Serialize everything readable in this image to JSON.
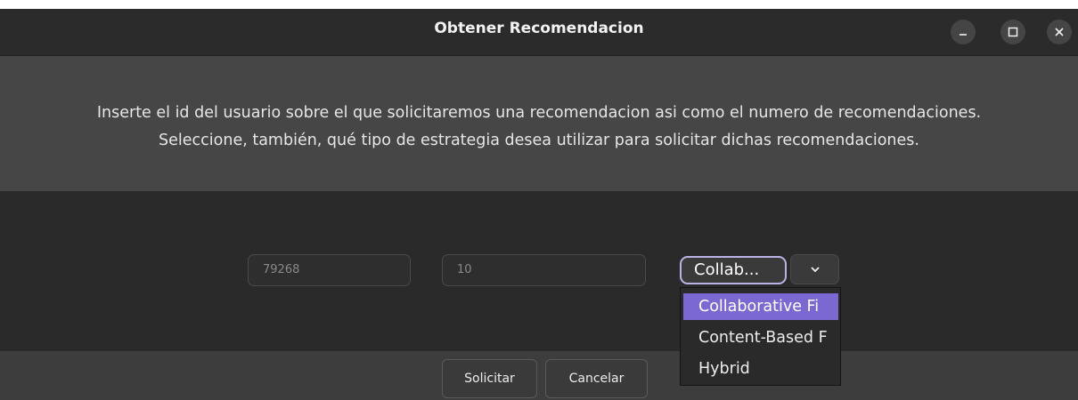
{
  "window": {
    "title": "Obtener Recomendacion"
  },
  "message": {
    "line1": "Inserte el id del usuario sobre el que solicitaremos una recomendacion asi como el numero de recomendaciones.",
    "line2": "Seleccione, también, qué tipo de estrategia desea utilizar para solicitar dichas recomendaciones."
  },
  "form": {
    "user_id_value": "79268",
    "num_recs_value": "10",
    "strategy_selected_label": "Collab..."
  },
  "dropdown": {
    "options": [
      {
        "label": "Collaborative Fi",
        "selected": true
      },
      {
        "label": "Content-Based F",
        "selected": false
      },
      {
        "label": "Hybrid",
        "selected": false
      }
    ]
  },
  "buttons": {
    "submit_label": "Solicitar",
    "cancel_label": "Cancelar"
  },
  "colors": {
    "accent": "#7b68d0",
    "focus_ring": "#bcb2e6",
    "background": "#2a2a2a"
  },
  "icons": {
    "minimize": "minimize-icon",
    "maximize": "maximize-icon",
    "close": "close-icon",
    "combo_arrow": "chevron-down-icon"
  }
}
